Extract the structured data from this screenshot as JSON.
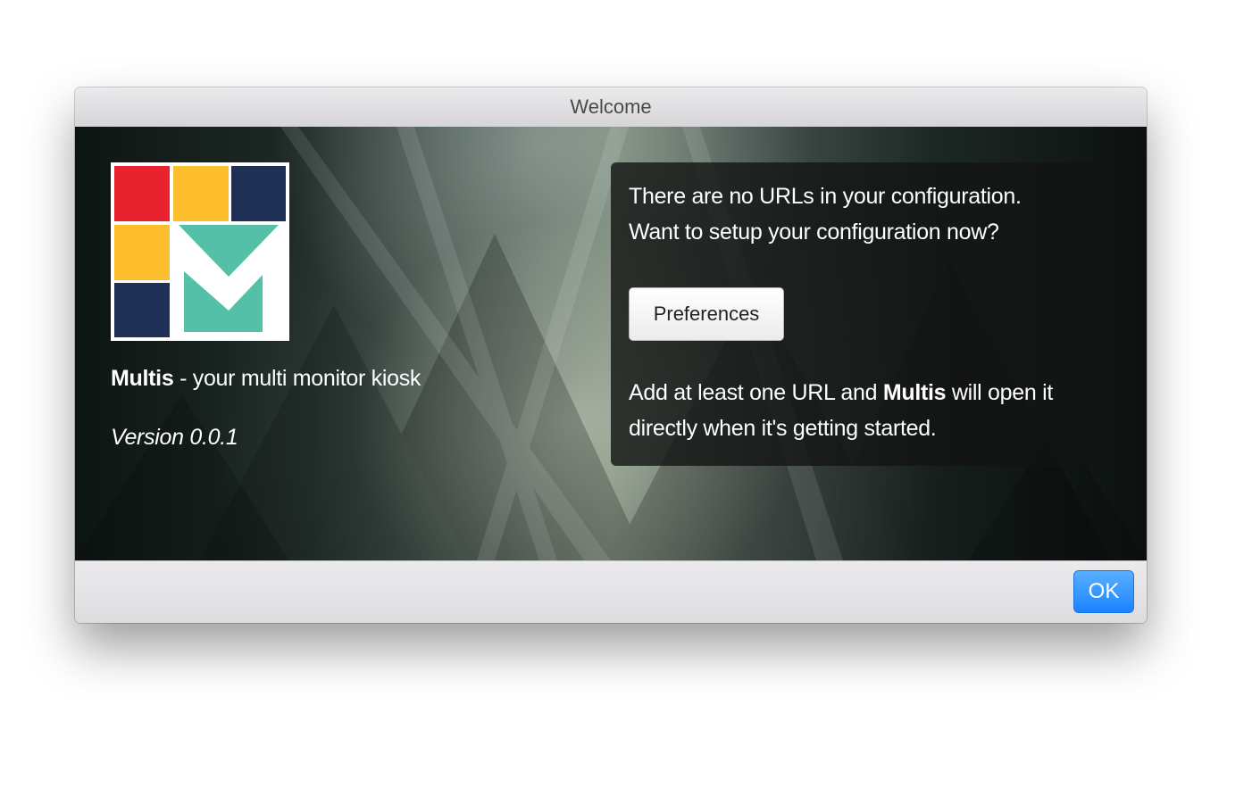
{
  "window": {
    "title": "Welcome"
  },
  "logo": {
    "colors": {
      "red": "#e8222f",
      "yellow": "#fdbe2e",
      "navy": "#1f2f55",
      "teal": "#55c0a8"
    }
  },
  "about": {
    "product_name": "Multis",
    "tagline": " - your multi monitor kiosk",
    "version": "Version 0.0.1"
  },
  "notice": {
    "line1": "There are no URLs in your configuration.",
    "line2": "Want to setup your configuration now?",
    "preferences_button": "Preferences",
    "hint_prefix": "Add at least one URL and ",
    "hint_product": "Multis",
    "hint_suffix": " will open it",
    "hint_line2": "directly when it's getting started."
  },
  "footer": {
    "ok_label": "OK",
    "ok_color": "#1a83ff"
  }
}
